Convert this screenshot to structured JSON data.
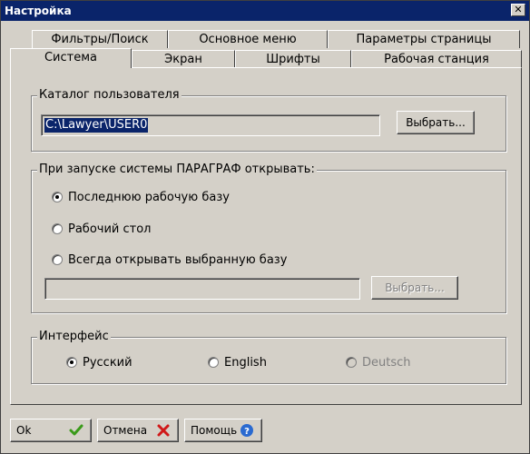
{
  "window": {
    "title": "Настройка",
    "close_glyph": "✕"
  },
  "tabs_row1": [
    {
      "label": "Фильтры/Поиск"
    },
    {
      "label": "Основное меню"
    },
    {
      "label": "Параметры страницы"
    }
  ],
  "tabs_row2": [
    {
      "label": "Система",
      "active": true
    },
    {
      "label": "Экран"
    },
    {
      "label": "Шрифты"
    },
    {
      "label": "Рабочая станция"
    }
  ],
  "user_catalog": {
    "group_title": "Каталог пользователя",
    "path_value": "C:\\Lawyer\\USER0",
    "choose_button": "Выбрать..."
  },
  "startup": {
    "group_title": "При запуске системы ПАРАГРАФ открывать:",
    "options": [
      {
        "label": "Последнюю рабочую базу",
        "checked": true
      },
      {
        "label": "Рабочий стол",
        "checked": false
      },
      {
        "label": "Всегда открывать выбранную базу",
        "checked": false
      }
    ],
    "base_path_value": "",
    "choose_button": "Выбрать..."
  },
  "interface": {
    "group_title": "Интерфейс",
    "options": [
      {
        "label": "Русский",
        "checked": true,
        "enabled": true
      },
      {
        "label": "English",
        "checked": false,
        "enabled": true
      },
      {
        "label": "Deutsch",
        "checked": false,
        "enabled": false
      }
    ]
  },
  "buttons": {
    "ok": "Ok",
    "cancel": "Отмена",
    "help": "Помощь"
  },
  "colors": {
    "titlebar": "#0a246a",
    "face": "#d4d0c8",
    "ok_check": "#3a9a1a",
    "cancel_x": "#d01818",
    "help_icon": "#2a6ad0"
  }
}
